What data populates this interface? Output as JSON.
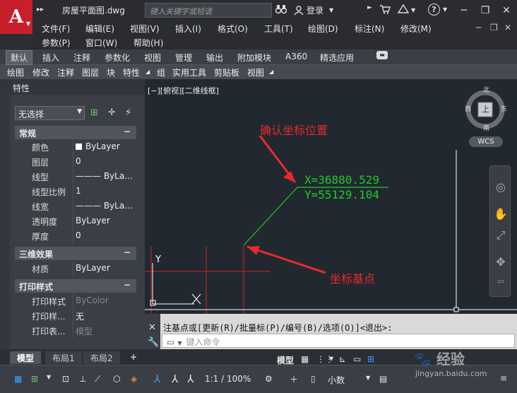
{
  "title_bar": {
    "logo": "A",
    "file_name": "房屋平面图.dwg",
    "search_placeholder": "键入关键字或短语",
    "login_label": "登录",
    "help_icon": "?",
    "quick_access_icon": "▸▸",
    "binoculars_icon": "binoculars-icon",
    "user_icon": "user-icon",
    "cart_icon": "cart-icon",
    "exchange_icon": "exchange-icon"
  },
  "menu": {
    "row1": [
      "文件(F)",
      "编辑(E)",
      "视图(V)",
      "插入(I)",
      "格式(O)",
      "工具(T)",
      "绘图(D)",
      "标注(N)",
      "修改(M)"
    ],
    "row2": [
      "参数(P)",
      "窗口(W)",
      "帮助(H)"
    ]
  },
  "ribbon_tabs": [
    "默认",
    "插入",
    "注释",
    "参数化",
    "视图",
    "管理",
    "输出",
    "附加模块",
    "A360",
    "精选应用"
  ],
  "ribbon_panels": [
    "绘图",
    "修改",
    "注释",
    "图层",
    "块",
    "特性",
    "组",
    "实用工具",
    "剪贴板",
    "视图"
  ],
  "properties": {
    "title": "特性",
    "selection": "无选择",
    "sections": [
      {
        "name": "常规",
        "rows": [
          {
            "label": "颜色",
            "value": "ByLayer",
            "swatch": true
          },
          {
            "label": "图层",
            "value": "0"
          },
          {
            "label": "线型",
            "value": "——— ByLa..."
          },
          {
            "label": "线型比例",
            "value": "1"
          },
          {
            "label": "线宽",
            "value": "——— ByLa..."
          },
          {
            "label": "透明度",
            "value": "ByLayer"
          },
          {
            "label": "厚度",
            "value": "0"
          }
        ]
      },
      {
        "name": "三维效果",
        "rows": [
          {
            "label": "材质",
            "value": "ByLayer"
          }
        ]
      },
      {
        "name": "打印样式",
        "rows": [
          {
            "label": "打印样式",
            "value": "ByColor",
            "dim": true
          },
          {
            "label": "打印样...",
            "value": "无"
          },
          {
            "label": "打印表...",
            "value": "模型",
            "dim": true
          }
        ]
      }
    ]
  },
  "canvas": {
    "viewport_label": "[−][俯视][二维线框]",
    "annotation_confirm": "确认坐标位置",
    "annotation_base": "坐标基点",
    "coord_x": "X=36880.529",
    "coord_y": "Y=55129.104",
    "ucs_y_label": "Y",
    "compass": {
      "n": "北",
      "s": "南",
      "w": "西",
      "e": "东",
      "top": "上"
    },
    "wcs_label": "WCS"
  },
  "command": {
    "history": "注基点或[更新(R)/批量标(P)/编号(B)/选项(O)]<退出>:",
    "input_placeholder": "键入命令"
  },
  "layout_tabs": [
    "模型",
    "布局1",
    "布局2"
  ],
  "add_tab": "+",
  "status": {
    "model": "模型",
    "scale": "1:1 / 100%",
    "units": "小数"
  },
  "watermark": {
    "site": "经验",
    "url": "jingyan.baidu.com"
  }
}
